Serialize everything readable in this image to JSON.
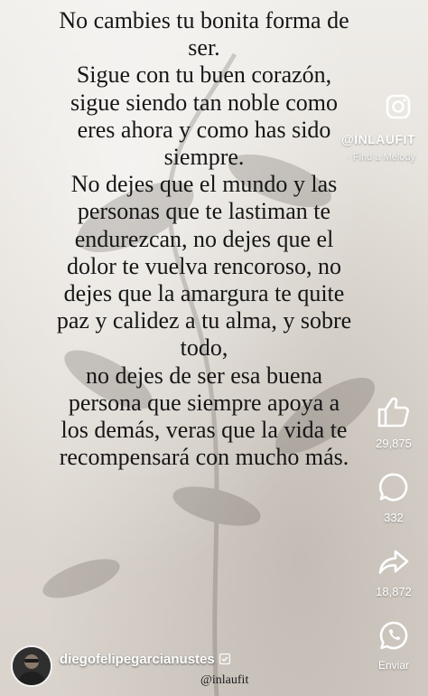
{
  "quote": {
    "paragraphs": [
      [
        "No cambies tu bonita forma de",
        "ser."
      ],
      [
        "Sigue con tu buen corazón,",
        "sigue siendo tan noble como",
        "eres ahora y como has sido",
        "siempre."
      ],
      [
        "No dejes que el mundo y las",
        "personas que te lastiman te",
        "endurezcan, no dejes que el",
        "dolor te vuelva rencoroso, no",
        "dejes que la amargura te quite",
        "paz y calidez a tu alma, y sobre",
        "todo,"
      ],
      [
        "no dejes de ser esa buena",
        "persona que siempre apoya a",
        "los demás, veras que la vida te",
        "recompensará con mucho más."
      ]
    ]
  },
  "side": {
    "handle": "@INLAUFIT",
    "music_prefix": "·",
    "music_label": "Find a Melody",
    "likes": "29,875",
    "comments": "332",
    "shares": "18,872",
    "send_label": "Enviar"
  },
  "footer": {
    "username": "diegofelipegarcianustes",
    "sub_handle": "@inlaufit"
  },
  "colors": {
    "text": "#161616",
    "icon": "#ffffff",
    "verified": "#ffffff"
  },
  "icons": {
    "instagram": "instagram-icon",
    "like": "thumbs-up-icon",
    "comment": "comment-bubble-icon",
    "share": "share-arrow-icon",
    "send": "whatsapp-icon",
    "verified": "verified-check-icon"
  }
}
